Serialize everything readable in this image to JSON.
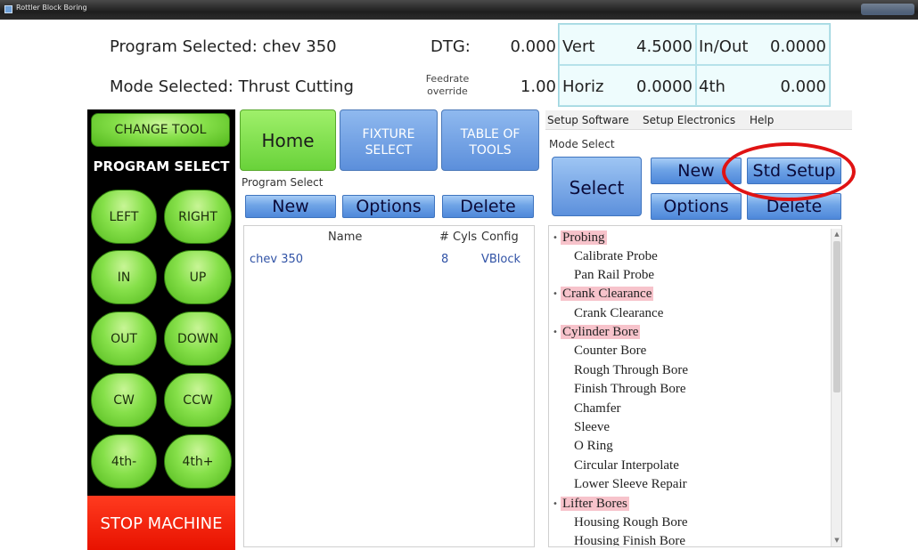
{
  "window": {
    "title": "Rottler Block Boring"
  },
  "header": {
    "program_selected": "Program Selected: chev 350",
    "mode_selected": "Mode Selected: Thrust Cutting",
    "dtg_label": "DTG:",
    "dtg_value": "0.000",
    "feedrate_label": "Feedrate override",
    "feedrate_value": "1.00",
    "readouts": {
      "vert_label": "Vert",
      "vert_value": "4.5000",
      "inout_label": "In/Out",
      "inout_value": "0.0000",
      "horiz_label": "Horiz",
      "horiz_value": "0.0000",
      "fourth_label": "4th",
      "fourth_value": "0.000"
    }
  },
  "left_panel": {
    "change_tool": "CHANGE TOOL",
    "program_select": "PROGRAM SELECT",
    "buttons": {
      "left": "LEFT",
      "right": "RIGHT",
      "in": "IN",
      "up": "UP",
      "out": "OUT",
      "down": "DOWN",
      "cw": "CW",
      "ccw": "CCW",
      "fourth_minus": "4th-",
      "fourth_plus": "4th+"
    },
    "stop": "STOP MACHINE"
  },
  "tabs": {
    "home": "Home",
    "fixture": "FIXTURE SELECT",
    "table_of_tools": "TABLE OF TOOLS"
  },
  "program_select": {
    "section_label": "Program Select",
    "new": "New",
    "options": "Options",
    "delete": "Delete",
    "columns": {
      "name": "Name",
      "cyls": "# Cyls",
      "config": "Config"
    },
    "rows": [
      {
        "name": "chev 350",
        "cyls": "8",
        "config": "VBlock"
      }
    ]
  },
  "menu": {
    "setup_software": "Setup Software",
    "setup_electronics": "Setup Electronics",
    "help": "Help"
  },
  "mode_select": {
    "section_label": "Mode Select",
    "select": "Select",
    "new": "New",
    "std_setup": "Std Setup",
    "options": "Options",
    "delete": "Delete",
    "tree": [
      {
        "category": "Probing",
        "items": [
          "Calibrate Probe",
          "Pan Rail Probe"
        ]
      },
      {
        "category": "Crank Clearance",
        "items": [
          "Crank Clearance"
        ]
      },
      {
        "category": "Cylinder Bore",
        "items": [
          "Counter Bore",
          "Rough Through Bore",
          "Finish Through Bore",
          "Chamfer",
          "Sleeve",
          "O Ring",
          "Circular Interpolate",
          "Lower Sleeve Repair"
        ]
      },
      {
        "category": "Lifter Bores",
        "items": [
          "Housing Rough Bore",
          "Housing Finish Bore"
        ]
      }
    ]
  },
  "colors": {
    "green_button": "#86e04a",
    "blue_button": "#6ea3e6",
    "stop_red": "#ff2a0f",
    "category_highlight": "#f7c3cb",
    "annotation_ring": "#e01313"
  }
}
